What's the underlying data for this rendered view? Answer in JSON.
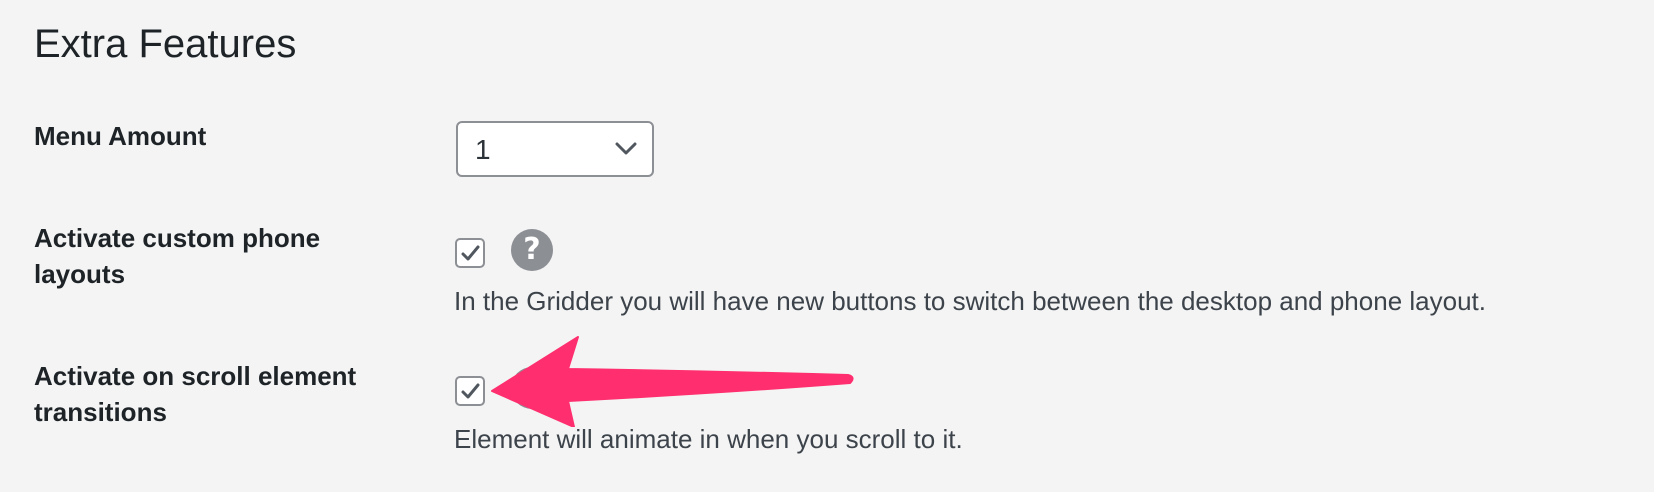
{
  "section": {
    "title": "Extra Features"
  },
  "menu_amount": {
    "label": "Menu Amount",
    "selected": "1"
  },
  "phone_layouts": {
    "label": "Activate custom phone layouts",
    "checked": true,
    "help_icon": "question-circle-icon",
    "help_glyph": "?",
    "description": "In the Gridder you will have new buttons to switch between the desktop and phone layout."
  },
  "scroll_transitions": {
    "label": "Activate on scroll element transitions",
    "checked": true,
    "help_icon": "question-circle-icon",
    "description": "Element will animate in when you scroll to it."
  },
  "annotation": {
    "icon": "arrow-left-icon",
    "color": "#ff2e6e"
  },
  "colors": {
    "background": "#f4f4f4",
    "checkbox_border": "#8c8f94",
    "check_mark": "#50575e",
    "help_icon_bg": "#8c8f94"
  }
}
